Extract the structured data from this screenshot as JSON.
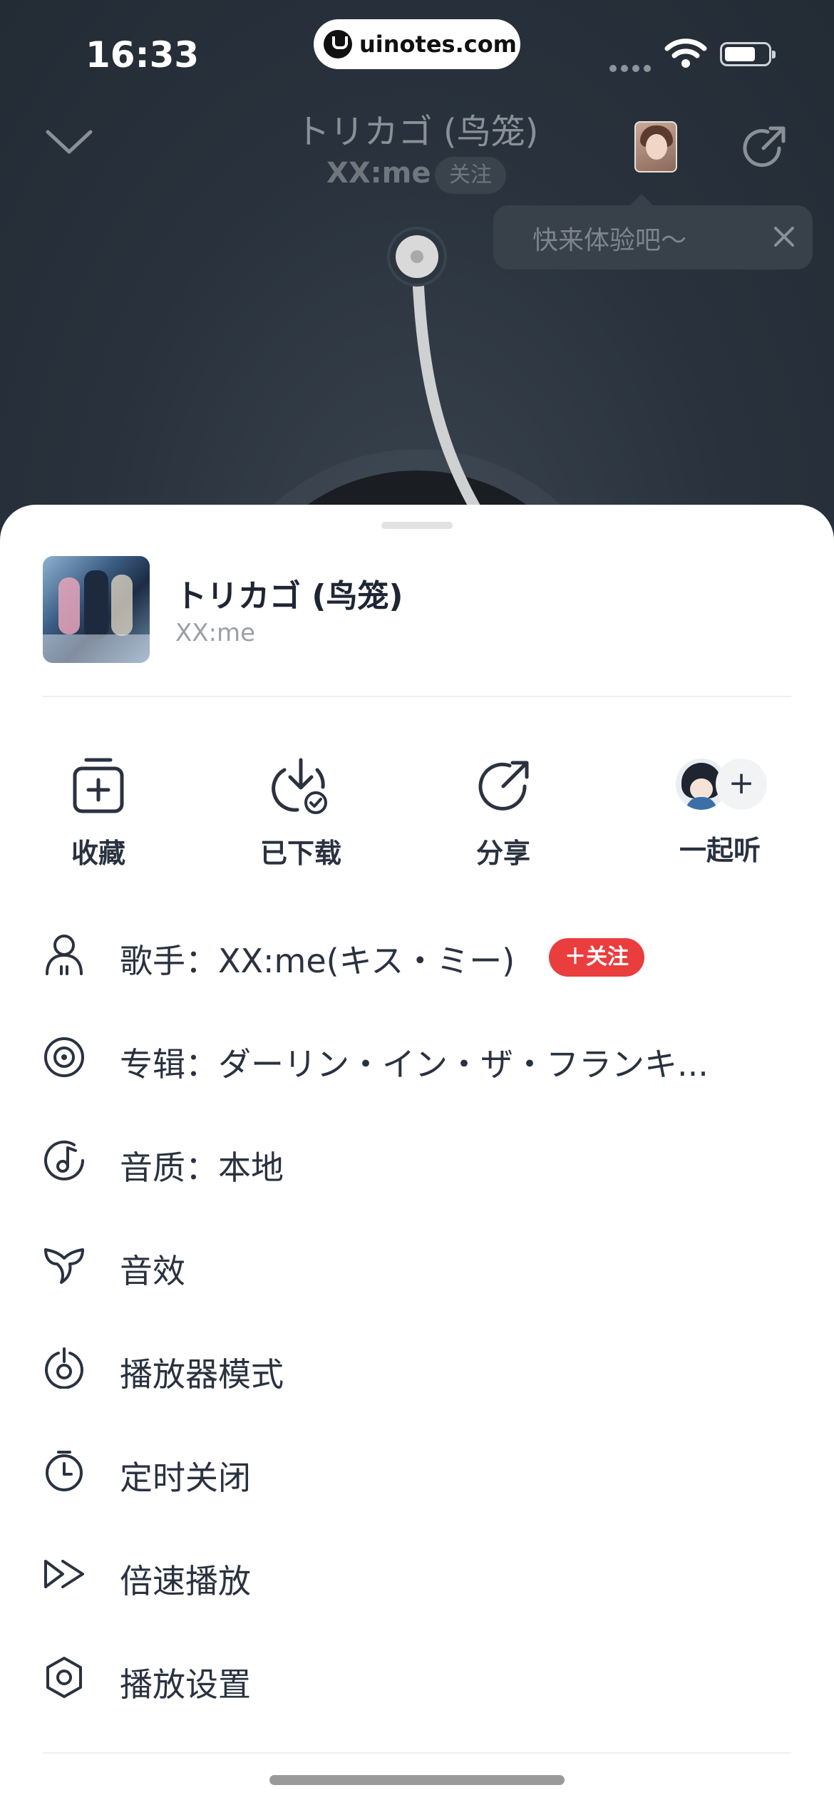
{
  "status_bar": {
    "time": "16:33",
    "watermark": "uinotes.com"
  },
  "player": {
    "title": "トリカゴ (鸟笼)",
    "artist": "XX:me",
    "follow_label": "关注",
    "tooltip": "快来体验吧～"
  },
  "sheet": {
    "song_title": "トリカゴ (鸟笼)",
    "song_artist": "XX:me",
    "actions": [
      {
        "label": "收藏",
        "icon": "add-to-playlist-icon"
      },
      {
        "label": "已下载",
        "icon": "downloaded-icon"
      },
      {
        "label": "分享",
        "icon": "share-icon"
      },
      {
        "label": "一起听",
        "icon": "listen-together-icon"
      }
    ],
    "menu": [
      {
        "label": "歌手：XX:me(キス・ミー)",
        "icon": "singer-icon",
        "badge": "＋关注"
      },
      {
        "label": "专辑：ダーリン・イン・ザ・フランキ...",
        "icon": "album-icon"
      },
      {
        "label": "音质：本地",
        "icon": "sound-quality-icon"
      },
      {
        "label": "音效",
        "icon": "sound-effect-icon"
      },
      {
        "label": "播放器模式",
        "icon": "player-mode-icon"
      },
      {
        "label": "定时关闭",
        "icon": "timer-icon"
      },
      {
        "label": "倍速播放",
        "icon": "speed-icon"
      },
      {
        "label": "播放设置",
        "icon": "settings-icon"
      }
    ]
  },
  "colors": {
    "accent_red": "#ea3d3d",
    "text_dark": "#2a3240",
    "text_muted": "#9ba0a6",
    "player_bg": "#29323c"
  }
}
